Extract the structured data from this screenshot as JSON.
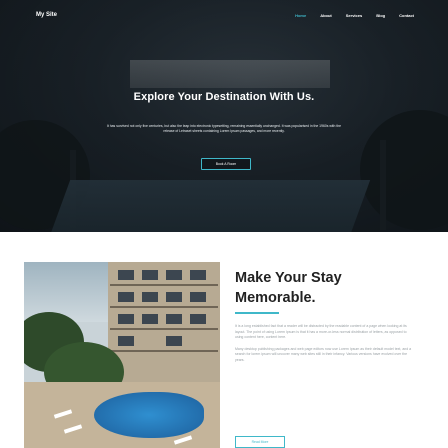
{
  "nav": {
    "brand": "My Site",
    "items": [
      {
        "label": "Home",
        "active": true
      },
      {
        "label": "About",
        "active": false
      },
      {
        "label": "Services",
        "active": false
      },
      {
        "label": "Blog",
        "active": false
      },
      {
        "label": "Contact",
        "active": false
      }
    ]
  },
  "hero": {
    "title": "Explore Your Destination With Us.",
    "text": "It has survived not only five centuries, but also the leap into electronic typesetting, remaining essentially unchanged. It was popularised in the 1960s with the release of Letraset sheets containing Lorem Ipsum passages, and more recently.",
    "button_label": "Book A Room"
  },
  "about": {
    "title": "Make Your Stay Memorable.",
    "paragraphs": [
      "It is a long established fact that a reader will be distracted by the readable content of a page when looking at its layout. The point of using Lorem Ipsum is that it has a more-or-less normal distribution of letters, as opposed to using content here, content here.",
      "Many desktop publishing packages and web page editors now use Lorem Ipsum as their default model text, and a search for lorem ipsum will uncover many web sites still in their infancy. Various versions have evolved over the years."
    ],
    "button_label": "Read More"
  },
  "colors": {
    "accent": "#3fb8c9",
    "heading": "#222222",
    "body_text": "#9aa1a5"
  }
}
